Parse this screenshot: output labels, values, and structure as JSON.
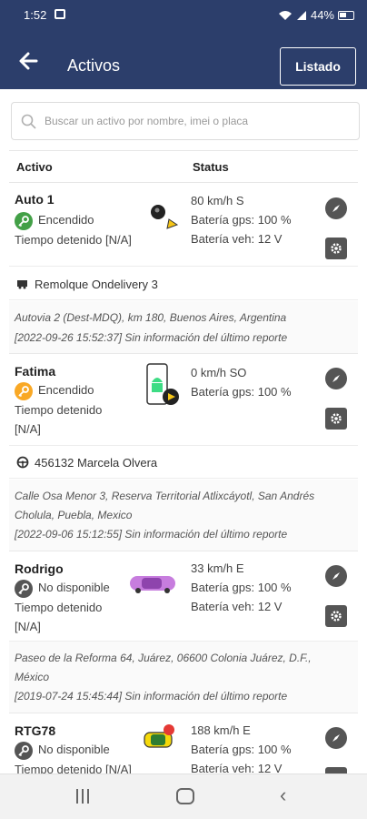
{
  "statusbar": {
    "time": "1:52",
    "battery": "44%"
  },
  "appbar": {
    "back_icon": "arrow-left-icon",
    "title": "Activos",
    "listado_label": "Listado"
  },
  "search": {
    "placeholder": "Buscar un activo por nombre, imei o placa"
  },
  "table": {
    "col_activo": "Activo",
    "col_status": "Status"
  },
  "assets": [
    {
      "name": "Auto 1",
      "state": "Encendido",
      "key_color": "#43a047",
      "stopped_label": "Tiempo detenido [N/A]",
      "speed": "80 km/h S",
      "gps_battery": "Batería gps: 100 %",
      "veh_battery": "Batería veh: 12 V",
      "driver": "Remolque Ondelivery 3",
      "address": "Autovia 2 (Dest-MDQ), km 180, Buenos Aires, Argentina",
      "report": "[2022-09-26 15:52:37] Sin información del último reporte"
    },
    {
      "name": "Fatima",
      "state": "Encendido",
      "key_color": "#f9a825",
      "stopped_label": "Tiempo detenido",
      "stopped_value": "[N/A]",
      "speed": "0 km/h SO",
      "gps_battery": "Batería gps: 100 %",
      "driver": "456132 Marcela Olvera",
      "address_line1": "Calle Osa Menor 3, Reserva Territorial Atlixcáyotl, San Andrés",
      "address_line2": "Cholula, Puebla, Mexico",
      "report": "[2022-09-06 15:12:55] Sin información del último reporte"
    },
    {
      "name": "Rodrigo",
      "state": "No disponible",
      "key_color": "#555555",
      "stopped_label": "Tiempo detenido",
      "stopped_value": "[N/A]",
      "speed": "33 km/h E",
      "gps_battery": "Batería gps: 100 %",
      "veh_battery": "Batería veh: 12 V",
      "address_line1": "Paseo de la Reforma 64, Juárez, 06600 Colonia Juárez, D.F.,",
      "address_line2": "México",
      "report": "[2019-07-24 15:45:44] Sin información del último reporte"
    },
    {
      "name": "RTG78",
      "state": "No disponible",
      "key_color": "#555555",
      "stopped_label": "Tiempo detenido [N/A]",
      "speed": "188 km/h E",
      "gps_battery": "Batería gps: 100 %",
      "veh_battery": "Batería veh: 12 V"
    }
  ]
}
